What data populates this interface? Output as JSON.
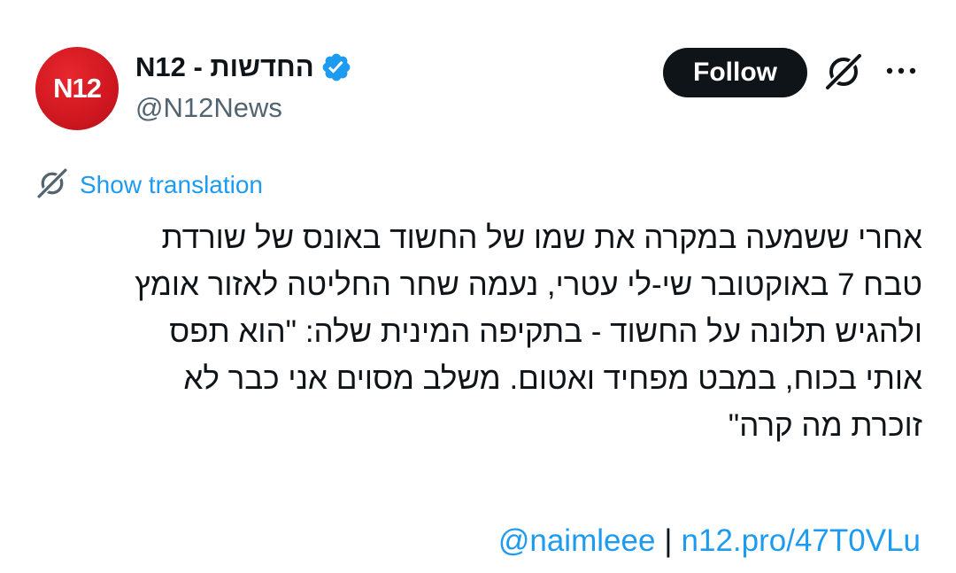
{
  "account": {
    "avatar_text": "N12",
    "display_name": "N12 - החדשות",
    "handle": "@N12News",
    "verified": true
  },
  "actions": {
    "follow_label": "Follow",
    "grok_icon": "grok-icon",
    "more_icon": "more-horizontal-icon"
  },
  "translation": {
    "label": "Show translation",
    "icon": "grok-icon"
  },
  "tweet": {
    "lines": [
      "אחרי ששמעה במקרה את שמו של החשוד באונס של שורדת",
      "טבח 7 באוקטובר שי-לי עטרי, נעמה שחר החליטה לאזור אומץ",
      "ולהגיש תלונה על החשוד - בתקיפה המינית שלה: \"הוא תפס",
      "אותי בכוח, במבט מפחיד ואטום. משלב מסוים אני כבר לא",
      "זוכרת מה קרה\""
    ],
    "mention": "@naimleee",
    "separator": "|",
    "link": "n12.pro/47T0VLu"
  },
  "colors": {
    "accent": "#1d9bf0",
    "text": "#0f1419",
    "secondary": "#536471",
    "brand": "#d81b23",
    "button_bg": "#0f1419"
  }
}
